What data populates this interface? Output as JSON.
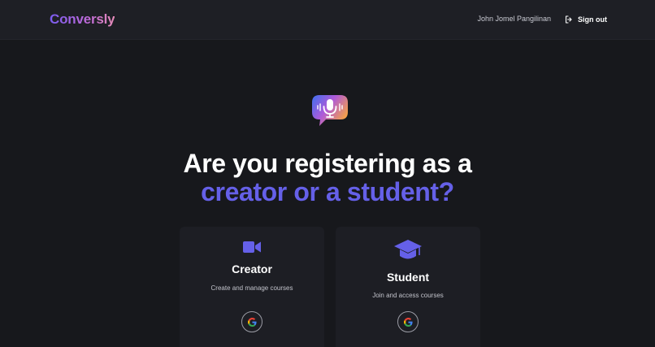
{
  "header": {
    "logo": "Conversly",
    "user_name": "John Jomel Pangilinan",
    "signout_label": "Sign out"
  },
  "hero": {
    "icon": "microphone-chat-icon",
    "title_line1": "Are you registering as a",
    "title_line2": "creator or a student?"
  },
  "cards": [
    {
      "id": "creator",
      "icon": "video-camera-icon",
      "title": "Creator",
      "description": "Create and manage courses",
      "button_icon": "google-icon"
    },
    {
      "id": "student",
      "icon": "graduation-cap-icon",
      "title": "Student",
      "description": "Join and access courses",
      "button_icon": "google-icon"
    }
  ],
  "colors": {
    "background": "#17181c",
    "topbar": "#1e1f25",
    "card": "#1d1e24",
    "accent": "#6560e8",
    "logo_gradient": [
      "#7a5cf0",
      "#e58bb8"
    ]
  }
}
